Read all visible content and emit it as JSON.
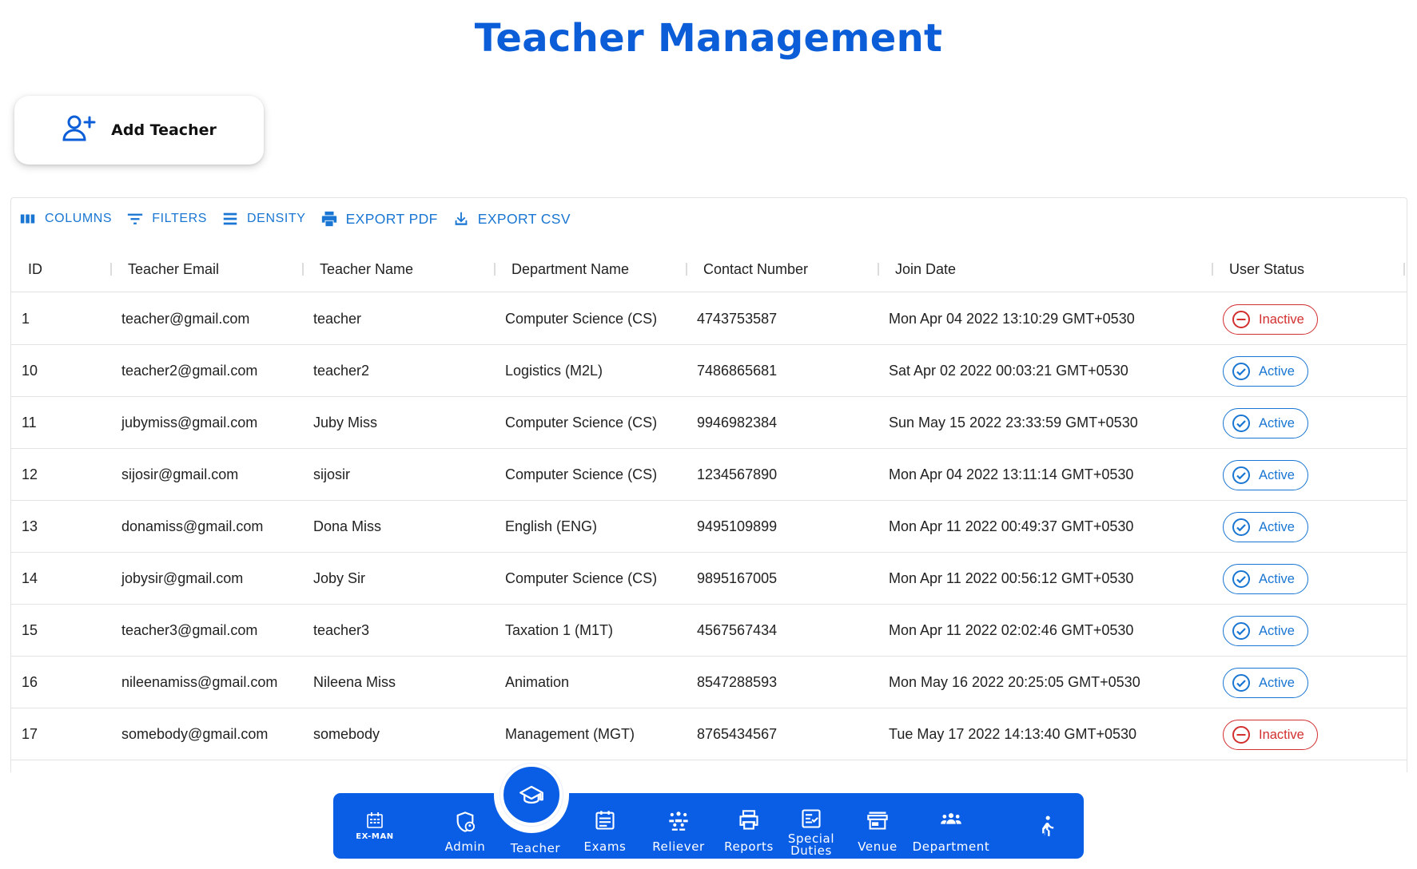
{
  "page_title": "Teacher Management",
  "add_button": {
    "label": "Add Teacher",
    "icon": "person-add-icon"
  },
  "toolbar": {
    "columns": "COLUMNS",
    "filters": "FILTERS",
    "density": "DENSITY",
    "export_pdf": "EXPORT PDF",
    "export_csv": "EXPORT CSV"
  },
  "table": {
    "headers": [
      "ID",
      "Teacher Email",
      "Teacher Name",
      "Department Name",
      "Contact Number",
      "Join Date",
      "User Status"
    ],
    "rows": [
      {
        "id": "1",
        "email": "teacher@gmail.com",
        "name": "teacher",
        "dept": "Computer Science (CS)",
        "contact": "4743753587",
        "join": "Mon Apr 04 2022 13:10:29 GMT+0530",
        "status": "Inactive"
      },
      {
        "id": "10",
        "email": "teacher2@gmail.com",
        "name": "teacher2",
        "dept": "Logistics (M2L)",
        "contact": "7486865681",
        "join": "Sat Apr 02 2022 00:03:21 GMT+0530",
        "status": "Active"
      },
      {
        "id": "11",
        "email": "jubymiss@gmail.com",
        "name": "Juby Miss",
        "dept": "Computer Science (CS)",
        "contact": "9946982384",
        "join": "Sun May 15 2022 23:33:59 GMT+0530",
        "status": "Active"
      },
      {
        "id": "12",
        "email": "sijosir@gmail.com",
        "name": "sijosir",
        "dept": "Computer Science (CS)",
        "contact": "1234567890",
        "join": "Mon Apr 04 2022 13:11:14 GMT+0530",
        "status": "Active"
      },
      {
        "id": "13",
        "email": "donamiss@gmail.com",
        "name": "Dona Miss",
        "dept": "English (ENG)",
        "contact": "9495109899",
        "join": "Mon Apr 11 2022 00:49:37 GMT+0530",
        "status": "Active"
      },
      {
        "id": "14",
        "email": "jobysir@gmail.com",
        "name": "Joby Sir",
        "dept": "Computer Science (CS)",
        "contact": "9895167005",
        "join": "Mon Apr 11 2022 00:56:12 GMT+0530",
        "status": "Active"
      },
      {
        "id": "15",
        "email": "teacher3@gmail.com",
        "name": "teacher3",
        "dept": "Taxation 1 (M1T)",
        "contact": "4567567434",
        "join": "Mon Apr 11 2022 02:02:46 GMT+0530",
        "status": "Active"
      },
      {
        "id": "16",
        "email": "nileenamiss@gmail.com",
        "name": "Nileena Miss",
        "dept": "Animation",
        "contact": "8547288593",
        "join": "Mon May 16 2022 20:25:05 GMT+0530",
        "status": "Active"
      },
      {
        "id": "17",
        "email": "somebody@gmail.com",
        "name": "somebody",
        "dept": "Management (MGT)",
        "contact": "8765434567",
        "join": "Tue May 17 2022 14:13:40 GMT+0530",
        "status": "Inactive"
      }
    ]
  },
  "bottom_nav": {
    "logo_text": "EX-MAN",
    "items": [
      {
        "label": "Admin",
        "icon": "admin-shield-icon"
      },
      {
        "label": "Teacher",
        "icon": "graduation-cap-icon",
        "selected": true
      },
      {
        "label": "Exams",
        "icon": "calendar-icon"
      },
      {
        "label": "Reliever",
        "icon": "group-icon"
      },
      {
        "label": "Reports",
        "icon": "printer-icon"
      },
      {
        "label": "Special Duties",
        "icon": "checklist-icon"
      },
      {
        "label": "Venue",
        "icon": "store-icon"
      },
      {
        "label": "Department",
        "icon": "people-icon"
      }
    ],
    "exit_icon": "walking-person-icon"
  },
  "colors": {
    "primary": "#0b5ed7",
    "nav_bg": "#0a5ee6",
    "active": "#1976d2",
    "inactive": "#d32f2f"
  }
}
